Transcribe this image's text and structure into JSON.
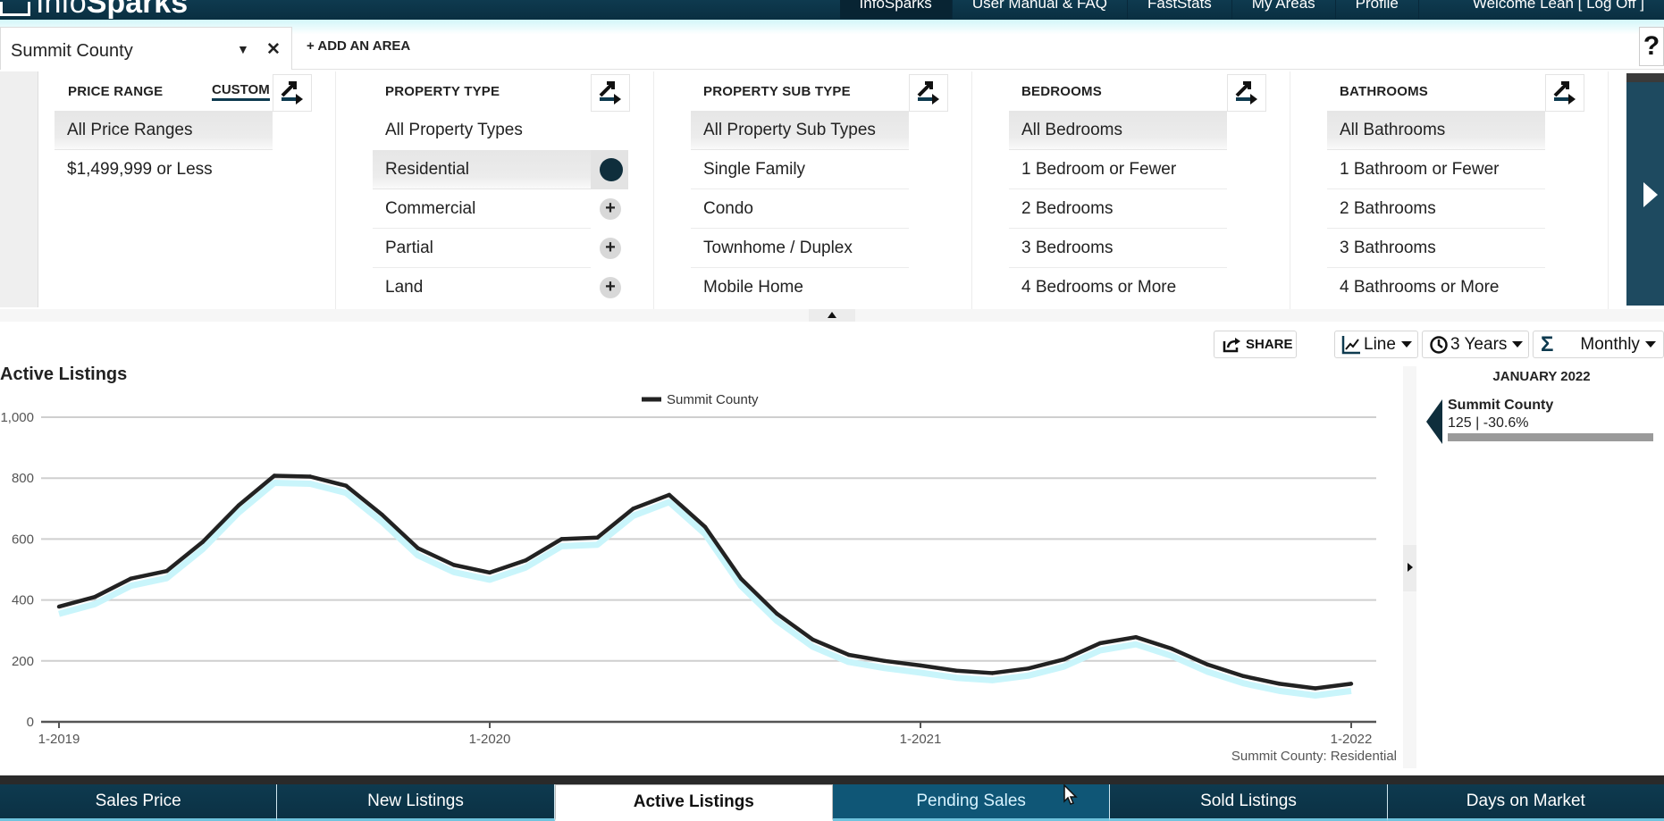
{
  "app": {
    "logo_thin": "Info",
    "logo_bold": "Sparks"
  },
  "topnav": {
    "links": [
      "InfoSparks",
      "User Manual & FAQ",
      "FastStats",
      "My Areas",
      "Profile",
      "Welcome Leah [ Log Off ]"
    ]
  },
  "area_bar": {
    "selected_area": "Summit County",
    "add_area_label": "+ ADD AN AREA",
    "help_label": "?"
  },
  "filters": {
    "price_range": {
      "heading": "PRICE RANGE",
      "custom_label": "CUSTOM",
      "items": [
        {
          "label": "All Price Ranges",
          "selected": true
        },
        {
          "label": "$1,499,999 or Less",
          "selected": false
        }
      ]
    },
    "property_type": {
      "heading": "PROPERTY TYPE",
      "items": [
        {
          "label": "All Property Types",
          "selected": false
        },
        {
          "label": "Residential",
          "selected": true
        },
        {
          "label": "Commercial",
          "selected": false
        },
        {
          "label": "Partial",
          "selected": false
        },
        {
          "label": "Land",
          "selected": false
        }
      ]
    },
    "property_sub_type": {
      "heading": "PROPERTY SUB TYPE",
      "items": [
        {
          "label": "All Property Sub Types",
          "selected": true
        },
        {
          "label": "Single Family",
          "selected": false
        },
        {
          "label": "Condo",
          "selected": false
        },
        {
          "label": "Townhome / Duplex",
          "selected": false
        },
        {
          "label": "Mobile Home",
          "selected": false
        }
      ]
    },
    "bedrooms": {
      "heading": "BEDROOMS",
      "items": [
        {
          "label": "All Bedrooms",
          "selected": true
        },
        {
          "label": "1 Bedroom or Fewer",
          "selected": false
        },
        {
          "label": "2 Bedrooms",
          "selected": false
        },
        {
          "label": "3 Bedrooms",
          "selected": false
        },
        {
          "label": "4 Bedrooms or More",
          "selected": false
        }
      ]
    },
    "bathrooms": {
      "heading": "BATHROOMS",
      "items": [
        {
          "label": "All Bathrooms",
          "selected": true
        },
        {
          "label": "1 Bathroom or Fewer",
          "selected": false
        },
        {
          "label": "2 Bathrooms",
          "selected": false
        },
        {
          "label": "3 Bathrooms",
          "selected": false
        },
        {
          "label": "4 Bathrooms or More",
          "selected": false
        }
      ]
    }
  },
  "toolbar": {
    "share_label": "SHARE",
    "chart_type": "Line",
    "time_range": "3 Years",
    "aggregation": "Monthly"
  },
  "readout": {
    "date": "JANUARY 2022",
    "series_name": "Summit County",
    "value_text": "125 | -30.6%",
    "bar_fraction": 1.0
  },
  "chart_data": {
    "type": "line",
    "title": "Active Listings",
    "xlabel": "",
    "ylabel": "",
    "ylim": [
      0,
      1000
    ],
    "yticks": [
      0,
      200,
      400,
      600,
      800,
      1000
    ],
    "ytick_labels": [
      "0",
      "200",
      "400",
      "600",
      "800",
      "1,000"
    ],
    "xtick_labels": [
      "1-2019",
      "1-2020",
      "1-2021",
      "1-2022"
    ],
    "xtick_indices": [
      0,
      12,
      24,
      36
    ],
    "grid": true,
    "legend_position": "top-center",
    "footnote": "Summit County: Residential",
    "x": [
      "1-2019",
      "2-2019",
      "3-2019",
      "4-2019",
      "5-2019",
      "6-2019",
      "7-2019",
      "8-2019",
      "9-2019",
      "10-2019",
      "11-2019",
      "12-2019",
      "1-2020",
      "2-2020",
      "3-2020",
      "4-2020",
      "5-2020",
      "6-2020",
      "7-2020",
      "8-2020",
      "9-2020",
      "10-2020",
      "11-2020",
      "12-2020",
      "1-2021",
      "2-2021",
      "3-2021",
      "4-2021",
      "5-2021",
      "6-2021",
      "7-2021",
      "8-2021",
      "9-2021",
      "10-2021",
      "11-2021",
      "12-2021",
      "1-2022"
    ],
    "series": [
      {
        "name": "Summit County",
        "color": "#222222",
        "values": [
          378,
          410,
          470,
          495,
          590,
          710,
          808,
          805,
          775,
          680,
          570,
          515,
          490,
          530,
          600,
          605,
          700,
          745,
          640,
          470,
          355,
          270,
          220,
          200,
          185,
          168,
          160,
          175,
          205,
          258,
          278,
          240,
          188,
          150,
          125,
          110,
          125
        ]
      }
    ]
  },
  "bottom_tabs": [
    {
      "label": "Sales Price",
      "state": "normal"
    },
    {
      "label": "New Listings",
      "state": "normal"
    },
    {
      "label": "Active Listings",
      "state": "active"
    },
    {
      "label": "Pending Sales",
      "state": "hover"
    },
    {
      "label": "Sold Listings",
      "state": "normal"
    },
    {
      "label": "Days on Market",
      "state": "normal"
    }
  ]
}
